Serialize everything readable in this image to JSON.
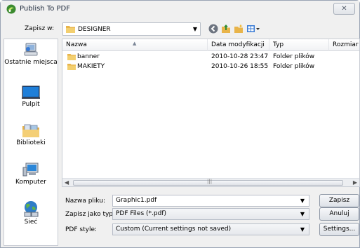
{
  "window": {
    "title": "Publish To PDF",
    "close_glyph": "✕"
  },
  "toolbar": {
    "lookin_label": "Zapisz w:",
    "lookin_value": "DESIGNER",
    "icons": [
      "back-icon",
      "up-folder-icon",
      "new-folder-icon",
      "view-menu-icon"
    ]
  },
  "places": [
    {
      "label": "Ostatnie miejsca",
      "icon": "recent-places-icon"
    },
    {
      "label": "Pulpit",
      "icon": "desktop-icon"
    },
    {
      "label": "Biblioteki",
      "icon": "libraries-icon"
    },
    {
      "label": "Komputer",
      "icon": "computer-icon"
    },
    {
      "label": "Sieć",
      "icon": "network-icon"
    }
  ],
  "filelist": {
    "columns": [
      "Nazwa",
      "Data modyfikacji",
      "Typ",
      "Rozmiar"
    ],
    "rows": [
      {
        "name": "banner",
        "date": "2010-10-28 23:47",
        "type": "Folder plików"
      },
      {
        "name": "MAKIETY",
        "date": "2010-10-26 18:55",
        "type": "Folder plików"
      }
    ]
  },
  "form": {
    "filename_label": "Nazwa pliku:",
    "filename_value": "Graphic1.pdf",
    "filetype_label": "Zapisz jako typ:",
    "filetype_value": "PDF Files (*.pdf)",
    "style_label": "PDF style:",
    "style_value": "Custom (Current settings not saved)"
  },
  "buttons": {
    "save": "Zapisz",
    "cancel": "Anuluj",
    "settings": "Settings..."
  },
  "colors": {
    "window_bg": "#f0f0f0",
    "folder": "#e8b44a",
    "border": "#9aa4b4"
  }
}
